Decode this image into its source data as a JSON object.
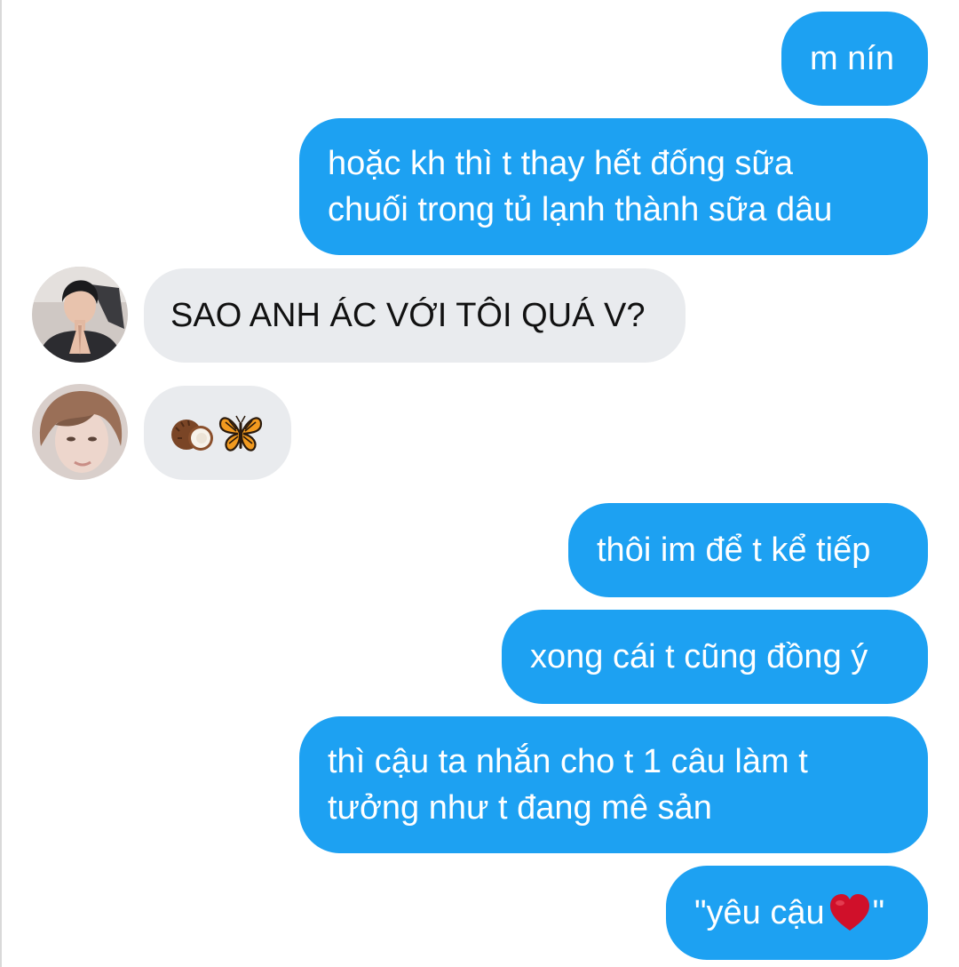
{
  "conversation": {
    "messages": [
      {
        "from": "me",
        "lines": [
          "m nín"
        ]
      },
      {
        "from": "me",
        "lines": [
          "hoặc kh thì t thay hết đống sữa",
          "chuối trong tủ lạnh thành sữa dâu"
        ]
      },
      {
        "from": "friend-1",
        "lines": [
          "SAO ANH ÁC VỚI TÔI QUÁ V?"
        ]
      },
      {
        "from": "friend-2",
        "emoji": [
          "coconut",
          "butterfly"
        ]
      },
      {
        "from": "me",
        "lines": [
          "thôi im để t kể tiếp"
        ]
      },
      {
        "from": "me",
        "lines": [
          "xong cái t cũng đồng ý"
        ]
      },
      {
        "from": "me",
        "lines": [
          "thì cậu ta nhắn cho t 1 câu làm t",
          "tưởng như t đang mê sản"
        ]
      },
      {
        "from": "me",
        "text_before": "\"yêu cậu",
        "icon": "red-heart-emoji",
        "text_after": "\""
      }
    ]
  },
  "colors": {
    "sent_bubble": "#1da1f2",
    "received_bubble": "#e9ebee",
    "sent_text": "#ffffff",
    "received_text": "#111111",
    "heart": "#d0102a"
  },
  "icons": {
    "avatar_1": "person-avatar",
    "avatar_2": "person-avatar",
    "emoji_1": "coconut-emoji",
    "emoji_2": "butterfly-emoji"
  }
}
